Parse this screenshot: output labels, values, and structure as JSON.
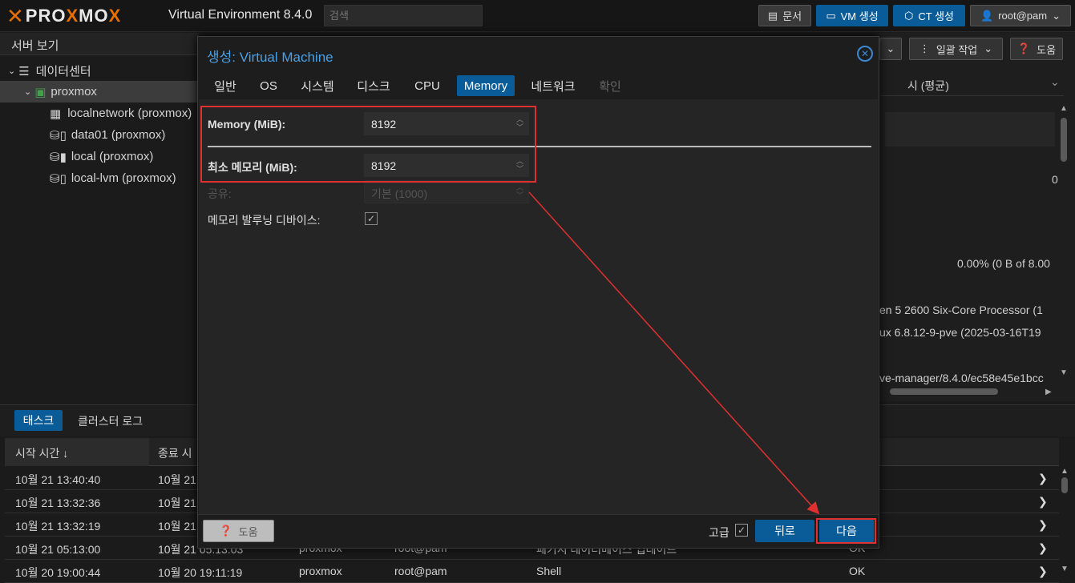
{
  "app": {
    "logo_text": "PROXMOX",
    "version": "Virtual Environment 8.4.0",
    "search_placeholder": "검색",
    "docs_label": "문서",
    "create_vm_label": "VM 생성",
    "create_ct_label": "CT 생성",
    "user_label": "root@pam"
  },
  "tree": {
    "header": "서버 보기",
    "items": [
      {
        "label": "데이터센터"
      },
      {
        "label": "proxmox"
      },
      {
        "label": "localnetwork (proxmox)"
      },
      {
        "label": "data01 (proxmox)"
      },
      {
        "label": "local (proxmox)"
      },
      {
        "label": "local-lvm (proxmox)"
      }
    ]
  },
  "right_panel": {
    "bulk_label": "일괄 작업",
    "help_label": "도움",
    "period_label": "시 (평균)",
    "zero_value": "0",
    "usage_text": "0.00% (0 B of 8.00",
    "cpu_text": "en 5 2600 Six-Core Processor (1",
    "kernel_text": "ux 6.8.12-9-pve (2025-03-16T19",
    "manager_text": "ve-manager/8.4.0/ec58e45e1bcc"
  },
  "tasks": {
    "tabs": [
      "태스크",
      "클러스터 로그"
    ],
    "columns": [
      "시작 시간 ↓",
      "종료 시"
    ],
    "rows": [
      {
        "start": "10월 21 13:40:40",
        "end": "10월 21",
        "node": "",
        "user": "",
        "desc": "",
        "status": ""
      },
      {
        "start": "10월 21 13:32:36",
        "end": "10월 21",
        "node": "",
        "user": "",
        "desc": "",
        "status": ""
      },
      {
        "start": "10월 21 13:32:19",
        "end": "10월 21",
        "node": "",
        "user": "",
        "desc": "",
        "status": ""
      },
      {
        "start": "10월 21 05:13:00",
        "end": "10월 21 05:13:03",
        "node": "proxmox",
        "user": "root@pam",
        "desc": "패키지 데이터베이스 업데이트",
        "status": "OK"
      },
      {
        "start": "10월 20 19:00:44",
        "end": "10월 20 19:11:19",
        "node": "proxmox",
        "user": "root@pam",
        "desc": "Shell",
        "status": "OK"
      }
    ]
  },
  "dialog": {
    "title_prefix": "생성:",
    "title": "Virtual Machine",
    "tabs": [
      "일반",
      "OS",
      "시스템",
      "디스크",
      "CPU",
      "Memory",
      "네트워크",
      "확인"
    ],
    "active_tab": "Memory",
    "fields": {
      "memory_label": "Memory (MiB):",
      "memory_value": "8192",
      "min_memory_label": "최소 메모리 (MiB):",
      "min_memory_value": "8192",
      "shares_label": "공유:",
      "shares_value": "기본 (1000)",
      "balloon_label": "메모리 발루닝 디바이스:"
    },
    "footer": {
      "help": "도움",
      "advanced": "고급",
      "back": "뒤로",
      "next": "다음"
    }
  },
  "colors": {
    "accent": "#0a5c99",
    "title_blue": "#4aa0e6",
    "annotation_red": "#e03030",
    "brand_orange": "#e57000"
  }
}
